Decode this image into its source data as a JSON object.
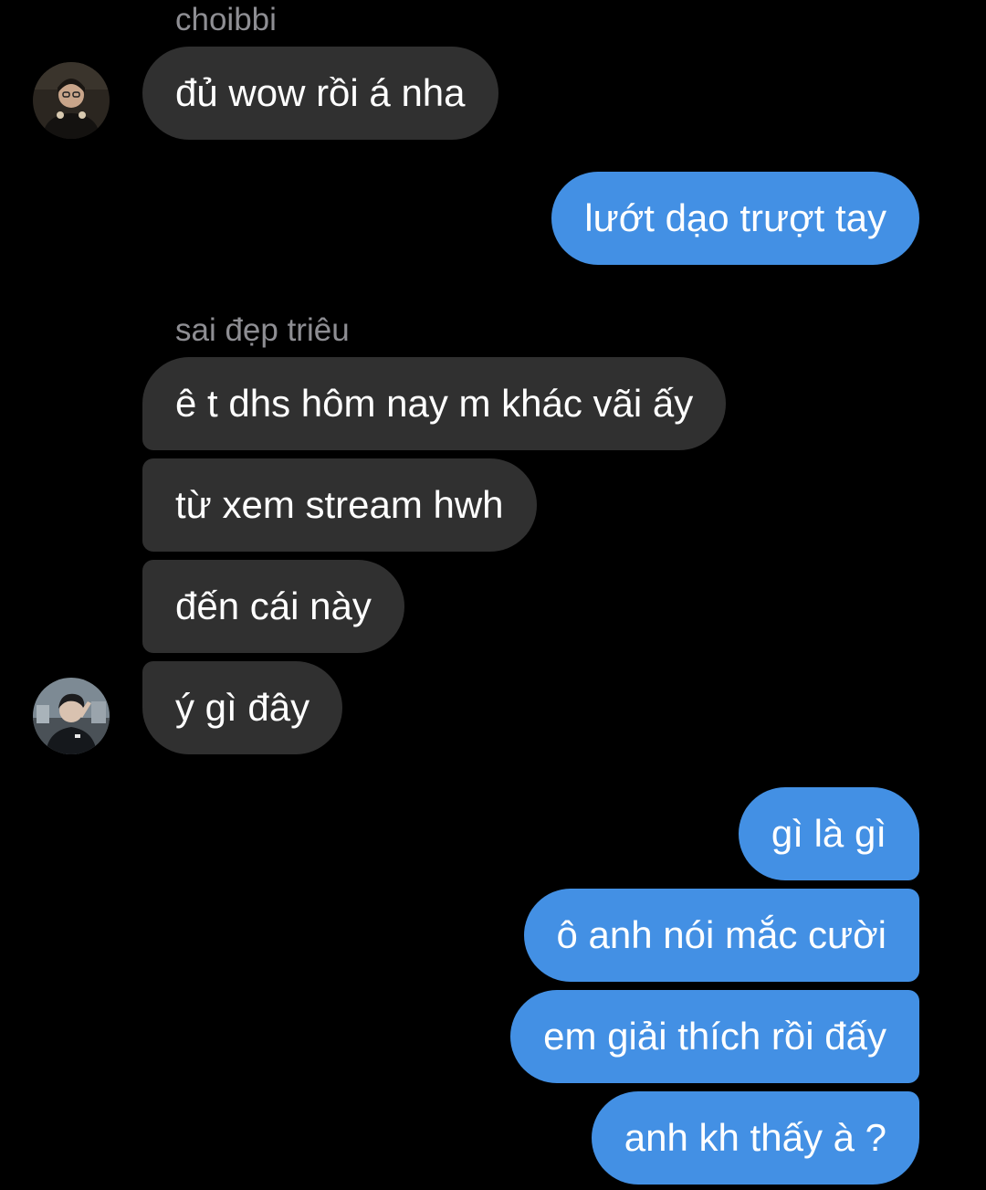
{
  "thread": {
    "groups": [
      {
        "sender": "choibbi",
        "avatar_icon": "avatar-choibbi",
        "messages": [
          "đủ wow rồi á nha"
        ]
      },
      {
        "sender": "me",
        "messages": [
          "lướt dạo trượt tay"
        ]
      },
      {
        "sender": "sai đẹp triêu",
        "avatar_icon": "avatar-sai-dep-trieu",
        "messages": [
          "ê t dhs hôm nay m khác vãi ấy",
          "từ xem stream hwh",
          "đến cái này",
          "ý gì đây"
        ]
      },
      {
        "sender": "me",
        "messages": [
          "gì là gì",
          "ô anh nói mắc cười",
          "em giải thích rồi đấy",
          "anh kh thấy à ?"
        ]
      }
    ]
  },
  "colors": {
    "background": "#000000",
    "incoming_bubble": "#303030",
    "outgoing_bubble": "#4390e4",
    "sender_name": "#8e8e93",
    "text": "#ffffff"
  }
}
